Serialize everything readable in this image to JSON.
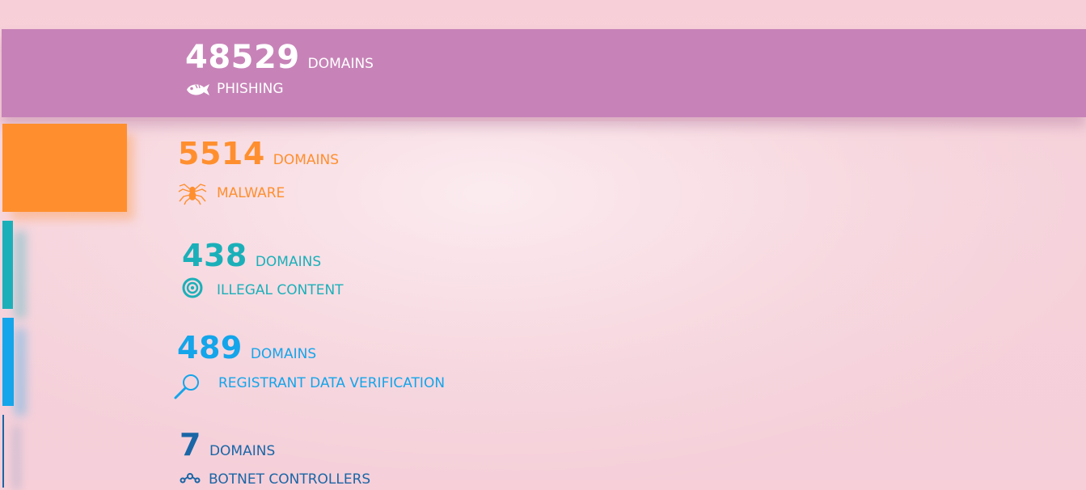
{
  "colors": {
    "background": "#f7cfd8",
    "phishing": "#c783b8",
    "malware": "#ff8f2e",
    "illegal_content": "#1bb0b9",
    "registrant_data_verification": "#14a5ea",
    "botnet_controllers": "#1a66a6"
  },
  "categories": [
    {
      "key": "phishing",
      "count": "48529",
      "unit": "DOMAINS",
      "label": "PHISHING",
      "icon": "fish-icon"
    },
    {
      "key": "malware",
      "count": "5514",
      "unit": "DOMAINS",
      "label": "MALWARE",
      "icon": "spider-icon"
    },
    {
      "key": "illegal_content",
      "count": "438",
      "unit": "DOMAINS",
      "label": "ILLEGAL CONTENT",
      "icon": "target-icon"
    },
    {
      "key": "registrant_data_verification",
      "count": "489",
      "unit": "DOMAINS",
      "label": "REGISTRANT DATA VERIFICATION",
      "icon": "magnifier-icon"
    },
    {
      "key": "botnet_controllers",
      "count": "7",
      "unit": "DOMAINS",
      "label": "BOTNET CONTROLLERS",
      "icon": "network-icon"
    }
  ]
}
